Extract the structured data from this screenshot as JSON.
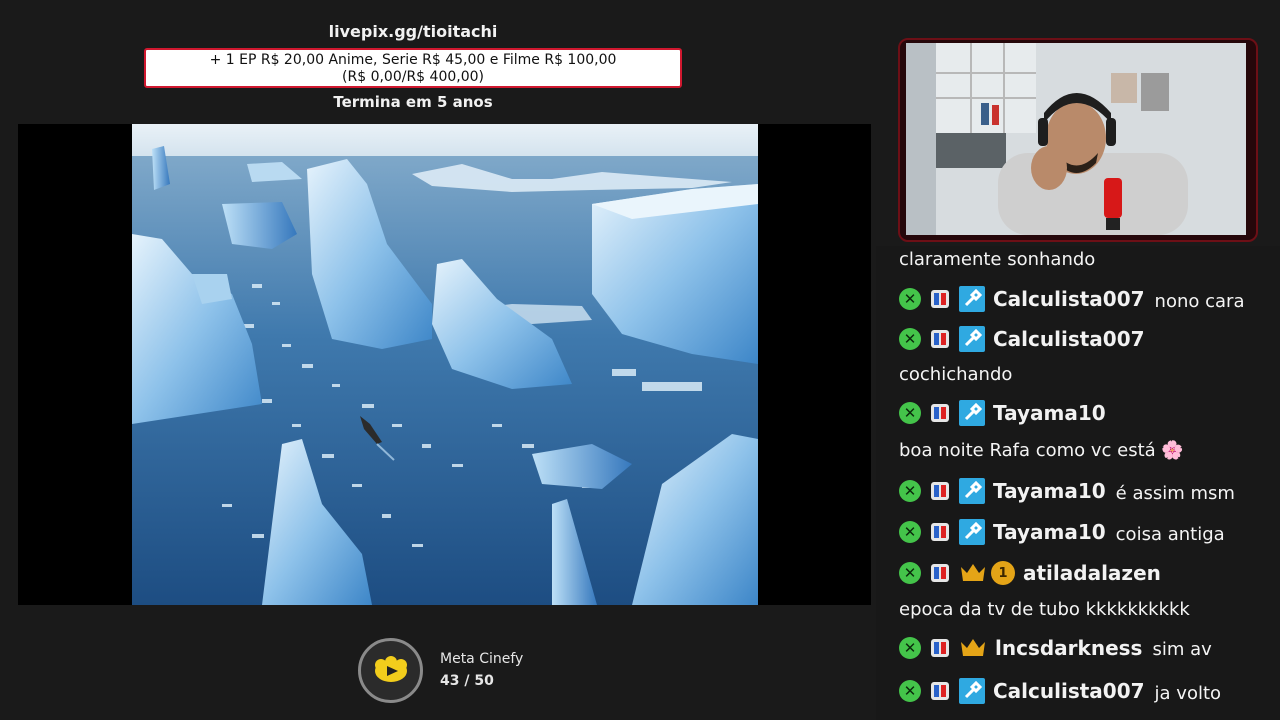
{
  "goal": {
    "url": "livepix.gg/tioitachi",
    "line1": "+ 1 EP R$ 20,00 Anime, Serie R$ 45,00 e Filme R$ 100,00",
    "line2": "(R$ 0,00/R$ 400,00)",
    "ends": "Termina em 5 anos",
    "progress_fraction": 0.0
  },
  "meta": {
    "title": "Meta Cinefy",
    "progress": "43 / 50",
    "current": 43,
    "target": 50
  },
  "colors": {
    "background": "#1a1a1a",
    "goal_border": "#d0182f",
    "mod_badge": "#2fa9e1",
    "k_badge": "#44c44a",
    "vip_crown": "#e4a417"
  },
  "chat": {
    "messages": [
      {
        "text": "claramente sonhando"
      },
      {
        "user": "Calculista007",
        "badges": [
          "k-icon",
          "flag-icon",
          "mod-icon"
        ],
        "text": "nono cara"
      },
      {
        "user": "Calculista007",
        "badges": [
          "k-icon",
          "flag-icon",
          "mod-icon"
        ],
        "text": ""
      },
      {
        "text": "cochichando"
      },
      {
        "user": "Tayama10",
        "badges": [
          "k-icon",
          "flag-icon",
          "mod-icon"
        ],
        "text": ""
      },
      {
        "text": "boa noite Rafa como vc está 🌸"
      },
      {
        "user": "Tayama10",
        "badges": [
          "k-icon",
          "flag-icon",
          "mod-icon"
        ],
        "text": "é assim msm"
      },
      {
        "user": "Tayama10",
        "badges": [
          "k-icon",
          "flag-icon",
          "mod-icon"
        ],
        "text": "coisa antiga"
      },
      {
        "user": "atiladalazen",
        "badges": [
          "k-icon",
          "flag-icon",
          "crown-icon",
          "sub-icon"
        ],
        "sub_months": "1",
        "text": ""
      },
      {
        "text": "epoca da tv de tubo kkkkkkkkkk"
      },
      {
        "user": "lncsdarkness",
        "badges": [
          "k-icon",
          "flag-icon",
          "crown-icon"
        ],
        "text": "sim av"
      },
      {
        "user": "Calculista007",
        "badges": [
          "k-icon",
          "flag-icon",
          "mod-icon"
        ],
        "text": "ja volto"
      }
    ]
  }
}
